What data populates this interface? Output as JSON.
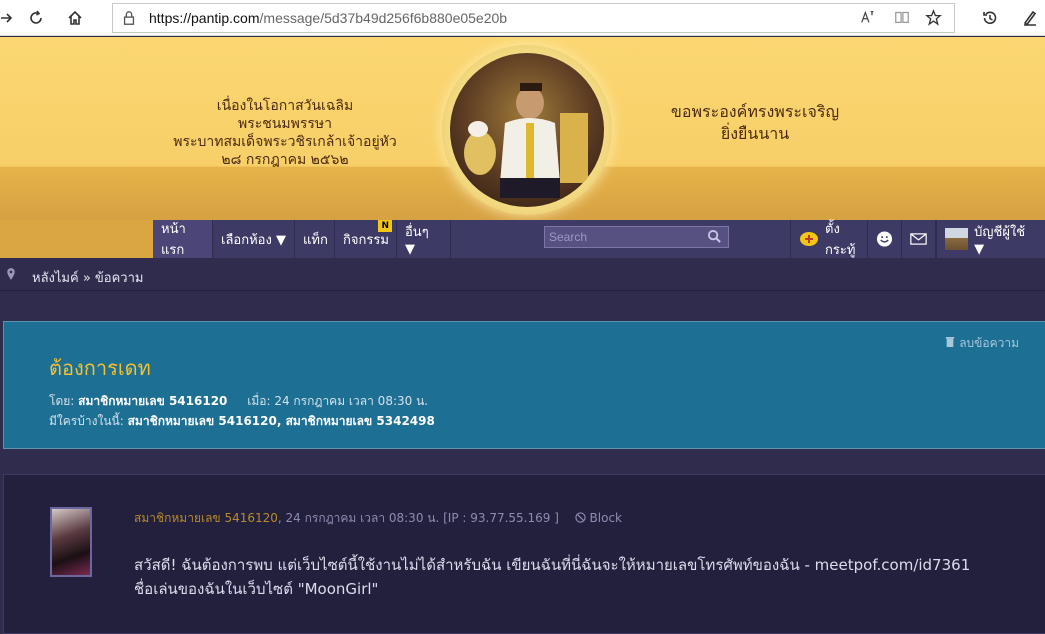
{
  "browser": {
    "url_host": "https://pantip.com",
    "url_path": "/message/5d37b49d256f6b880e05e20b"
  },
  "banner": {
    "left_line1": "เนื่องในโอกาสวันเฉลิมพระชนมพรรษา",
    "left_line2": "พระบาทสมเด็จพระวชิรเกล้าเจ้าอยู่หัว",
    "left_line3": "๒๘ กรกฎาคม ๒๕๖๒",
    "right_line1": "ขอพระองค์ทรงพระเจริญ",
    "right_line2": "ยิ่งยืนนาน"
  },
  "nav": {
    "home": "หน้าแรก",
    "rooms": "เลือกห้อง ▼",
    "tags": "แท็ก",
    "activities": "กิจกรรม",
    "activities_badge": "N",
    "more": "อื่นๆ ▼",
    "search_placeholder": "Search",
    "new_topic": "ตั้งกระทู้",
    "account": "บัญชีผู้ใช้ ▼"
  },
  "breadcrumb": {
    "text": "หลังไมค์ » ข้อความ"
  },
  "topic": {
    "title": "ต้องการเดท",
    "delete_label": "ลบข้อความ",
    "by_label": "โดย:",
    "by_user": "สมาชิกหมายเลข 5416120",
    "when_label": "เมื่อ:",
    "when_value": "24 กรกฎาคม เวลา 08:30 น.",
    "participants_label": "มีใครบ้างในนี้:",
    "participants": "สมาชิกหมายเลข 5416120, สมาชิกหมายเลข 5342498"
  },
  "message": {
    "user": "สมาชิกหมายเลข 5416120",
    "meta": ", 24 กรกฎาคม เวลา 08:30 น. [IP : 93.77.55.169 ]",
    "block": "Block",
    "line1": "สวัสดี! ฉันต้องการพบ แต่เว็บไซต์นี้ใช้งานไม่ได้สำหรับฉัน เขียนฉันที่นี่ฉันจะให้หมายเลขโทรศัพท์ของฉัน - meetpof.com/id7361",
    "line2": "ชื่อเล่นของฉันในเว็บไซต์ \"MoonGirl\""
  }
}
